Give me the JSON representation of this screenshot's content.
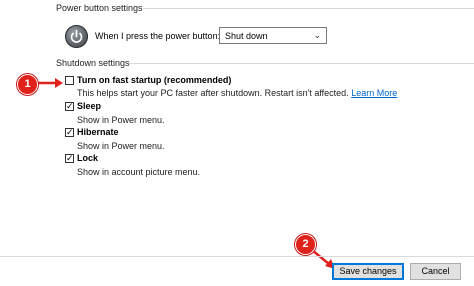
{
  "power_button_settings": {
    "title": "Power button settings",
    "label": "When I press the power button:",
    "selected": "Shut down"
  },
  "shutdown_settings": {
    "title": "Shutdown settings",
    "options": [
      {
        "title": "Turn on fast startup (recommended)",
        "desc": "This helps start your PC faster after shutdown. Restart isn't affected.",
        "link": "Learn More",
        "checked": false
      },
      {
        "title": "Sleep",
        "desc": "Show in Power menu.",
        "checked": true
      },
      {
        "title": "Hibernate",
        "desc": "Show in Power menu.",
        "checked": true
      },
      {
        "title": "Lock",
        "desc": "Show in account picture menu.",
        "checked": true
      }
    ]
  },
  "markers": {
    "one": "1",
    "two": "2"
  },
  "buttons": {
    "save": "Save changes",
    "cancel": "Cancel"
  },
  "colors": {
    "marker": "#e0211c",
    "link": "#0066cc",
    "accent": "#0078d7"
  }
}
